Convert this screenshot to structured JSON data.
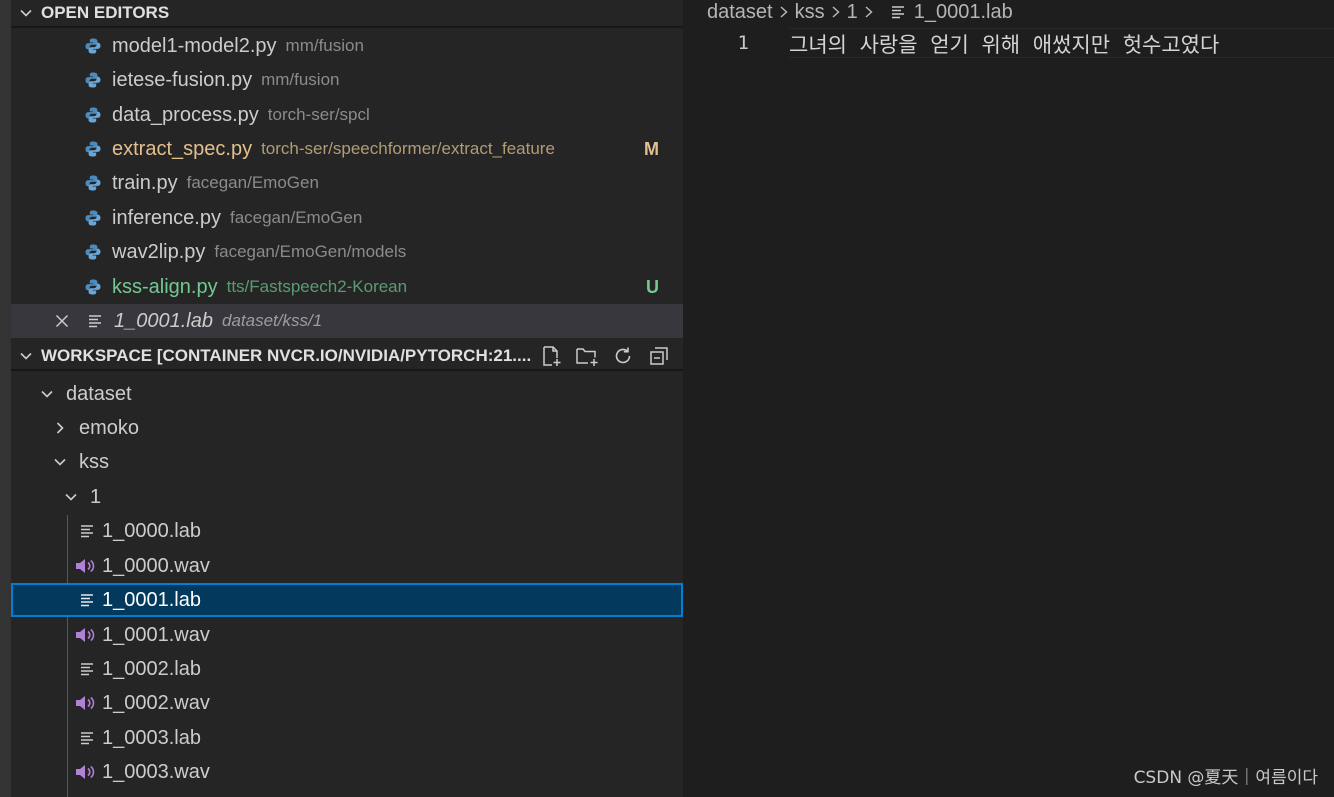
{
  "open_editors": {
    "title": "OPEN EDITORS",
    "items": [
      {
        "name": "model1-model2.py",
        "path": "mm/fusion",
        "badge": "",
        "kind": "py"
      },
      {
        "name": "ietese-fusion.py",
        "path": "mm/fusion",
        "badge": "",
        "kind": "py"
      },
      {
        "name": "data_process.py",
        "path": "torch-ser/spcl",
        "badge": "",
        "kind": "py"
      },
      {
        "name": "extract_spec.py",
        "path": "torch-ser/speechformer/extract_feature",
        "badge": "M",
        "kind": "py"
      },
      {
        "name": "train.py",
        "path": "facegan/EmoGen",
        "badge": "",
        "kind": "py"
      },
      {
        "name": "inference.py",
        "path": "facegan/EmoGen",
        "badge": "",
        "kind": "py"
      },
      {
        "name": "wav2lip.py",
        "path": "facegan/EmoGen/models",
        "badge": "",
        "kind": "py"
      },
      {
        "name": "kss-align.py",
        "path": "tts/Fastspeech2-Korean",
        "badge": "U",
        "kind": "py"
      },
      {
        "name": "1_0001.lab",
        "path": "dataset/kss/1",
        "badge": "",
        "kind": "lab"
      }
    ]
  },
  "workspace": {
    "title": "WORKSPACE [CONTAINER NVCR.IO/NVIDIA/PYTORCH:21....",
    "tree": [
      {
        "label": "dataset",
        "type": "folder"
      },
      {
        "label": "emoko",
        "type": "folder"
      },
      {
        "label": "kss",
        "type": "folder"
      },
      {
        "label": "1",
        "type": "folder"
      },
      {
        "label": "1_0000.lab",
        "type": "lab"
      },
      {
        "label": "1_0000.wav",
        "type": "wav"
      },
      {
        "label": "1_0001.lab",
        "type": "lab"
      },
      {
        "label": "1_0001.wav",
        "type": "wav"
      },
      {
        "label": "1_0002.lab",
        "type": "lab"
      },
      {
        "label": "1_0002.wav",
        "type": "wav"
      },
      {
        "label": "1_0003.lab",
        "type": "lab"
      },
      {
        "label": "1_0003.wav",
        "type": "wav"
      }
    ]
  },
  "editor": {
    "breadcrumb": [
      "dataset",
      "kss",
      "1",
      "1_0001.lab"
    ],
    "line_number": "1",
    "line_text": "그녀의 사랑을 얻기 위해 애썼지만 헛수고였다"
  },
  "watermark": "CSDN @夏天｜여름이다",
  "colors": {
    "modified": "#e2c08d",
    "untracked": "#73c991",
    "selection": "#04395e",
    "focus_border": "#007fd4",
    "python_icon": "#4b8bbe",
    "audio_icon": "#b180d7"
  }
}
